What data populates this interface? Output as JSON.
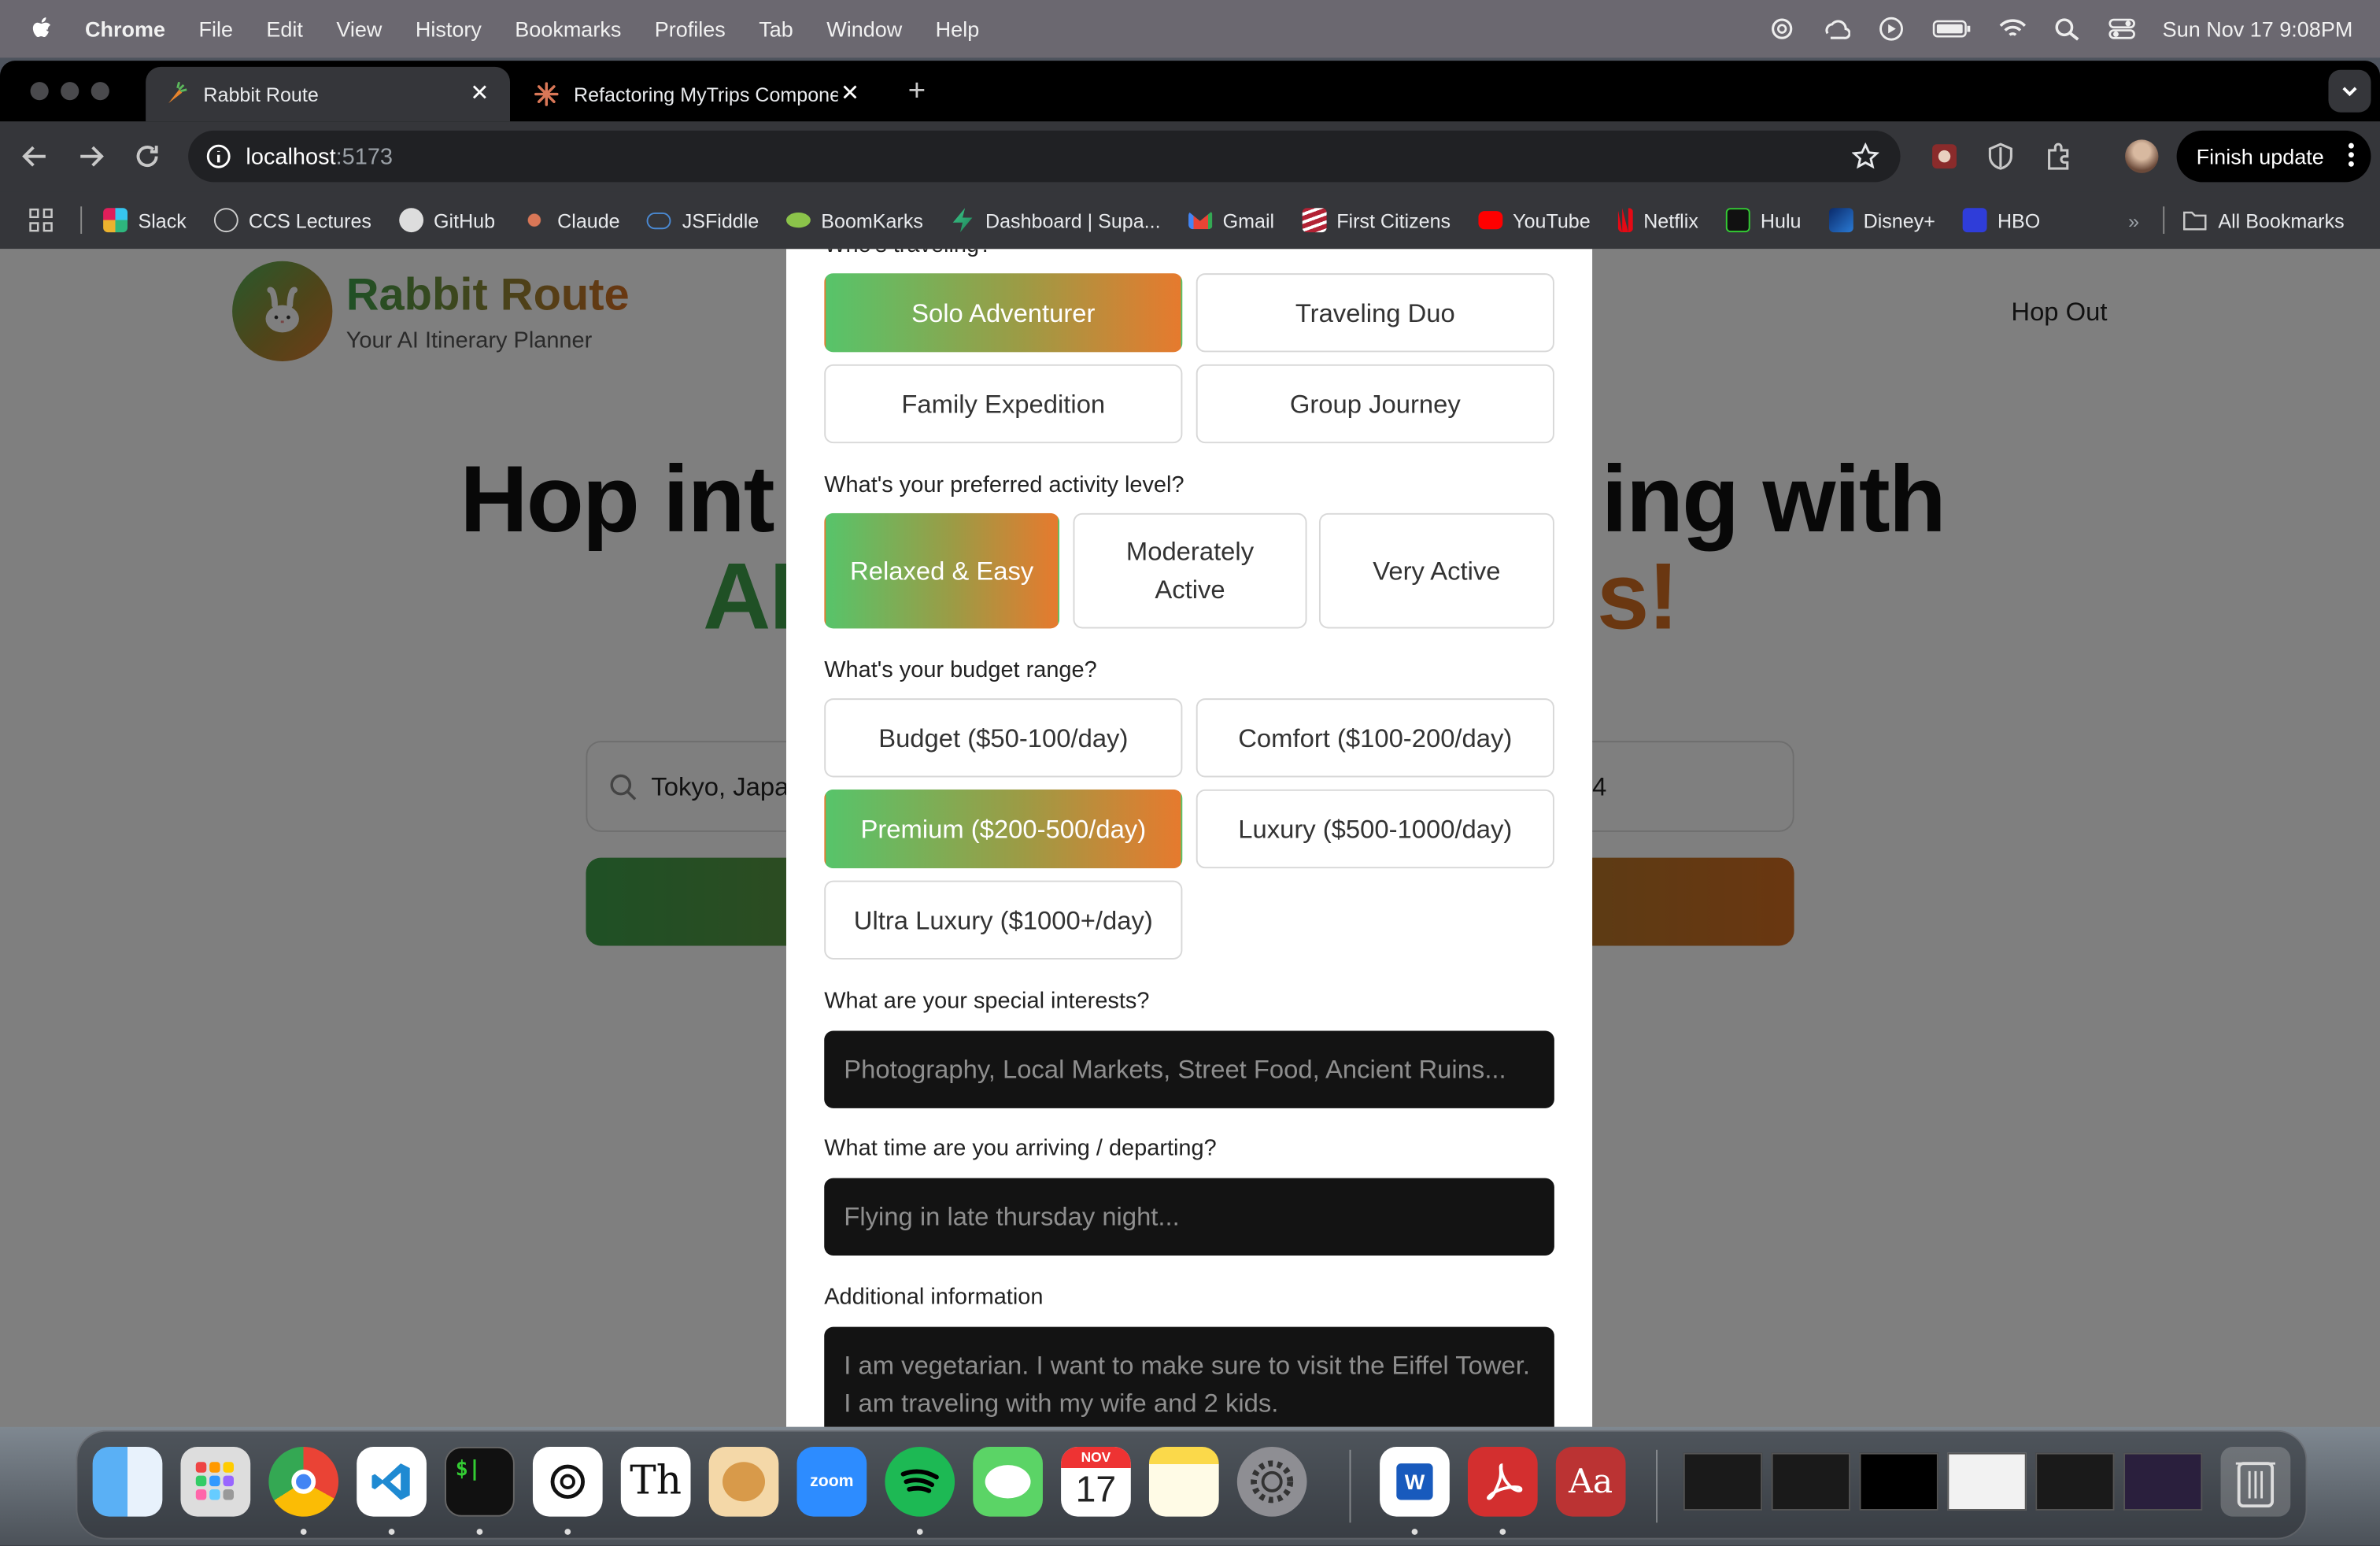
{
  "menubar": {
    "app": "Chrome",
    "items": [
      "File",
      "Edit",
      "View",
      "History",
      "Bookmarks",
      "Profiles",
      "Tab",
      "Window",
      "Help"
    ],
    "clock": "Sun Nov 17  9:08PM"
  },
  "tabs": [
    {
      "title": "Rabbit Route",
      "close": "✕"
    },
    {
      "title": "Refactoring MyTrips Compone",
      "close": "✕"
    }
  ],
  "newtab": "+",
  "omnibox": {
    "host": "localhost",
    "port": ":5173"
  },
  "finish_update": "Finish update",
  "bookmarks": [
    "Slack",
    "CCS Lectures",
    "GitHub",
    "Claude",
    "JSFiddle",
    "BoomKarks",
    "Dashboard | Supa...",
    "Gmail",
    "First Citizens",
    "YouTube",
    "Netflix",
    "Hulu",
    "Disney+",
    "HBO"
  ],
  "all_bookmarks": "All Bookmarks",
  "bookmarks_more": "»",
  "site": {
    "brand": "Rabbit Route",
    "tagline": "Your AI Itinerary Planner",
    "hop_out": "Hop Out",
    "hero_left": "Hop int",
    "hero_right": "ing with",
    "hero2_left": "AI",
    "hero2_right": "s!",
    "search_value": "Tokyo, Japa",
    "date_fragment": "4"
  },
  "modal": {
    "travel_q_partial": "Who's traveling?",
    "travel_options": [
      "Solo Adventurer",
      "Traveling Duo",
      "Family Expedition",
      "Group Journey"
    ],
    "activity_q": "What's your preferred activity level?",
    "activity_options": [
      "Relaxed & Easy",
      "Moderately Active",
      "Very Active"
    ],
    "budget_q": "What's your budget range?",
    "budget_options": [
      "Budget ($50-100/day)",
      "Comfort ($100-200/day)",
      "Premium ($200-500/day)",
      "Luxury ($500-1000/day)",
      "Ultra Luxury ($1000+/day)"
    ],
    "interests_q": "What are your special interests?",
    "interests_placeholder": "Photography, Local Markets, Street Food, Ancient Ruins...",
    "time_q": "What time are you arriving / departing?",
    "time_placeholder": "Flying in late thursday night...",
    "additional_q": "Additional information",
    "additional_placeholder": "I am vegetarian. I want to make sure to visit the Eiffel Tower. I am traveling with my wife and 2 kids."
  },
  "dock": {
    "zoom_label": "zoom",
    "calendar_month": "NOV",
    "calendar_day": "17",
    "word_label": "W",
    "dict_label": "Aa",
    "typeface_label": "Th",
    "terminal_label": "$|"
  },
  "colors": {
    "accent_green": "#3fa14b",
    "accent_orange": "#d46e22",
    "field_bg": "#131313"
  }
}
